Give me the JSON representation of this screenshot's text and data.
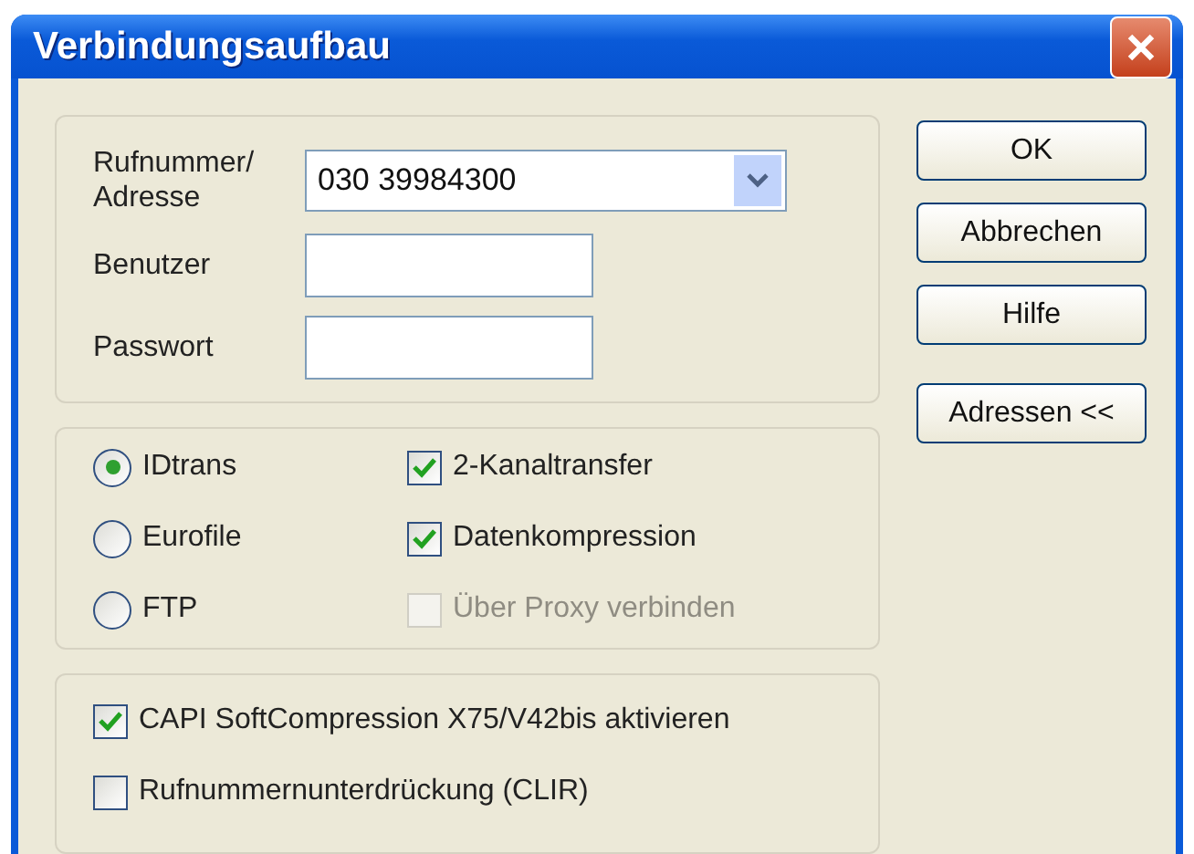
{
  "window": {
    "title": "Verbindungsaufbau"
  },
  "connection": {
    "address_label": "Rufnummer/ Adresse",
    "address_value": "030 39984300",
    "user_label": "Benutzer",
    "password_label": "Passwort"
  },
  "protocols": [
    {
      "label": "IDtrans",
      "selected": true
    },
    {
      "label": "Eurofile",
      "selected": false
    },
    {
      "label": "FTP",
      "selected": false
    }
  ],
  "options": [
    {
      "label": "2-Kanaltransfer",
      "checked": true,
      "disabled": false
    },
    {
      "label": "Datenkompression",
      "checked": true,
      "disabled": false
    },
    {
      "label": "Über Proxy verbinden",
      "checked": false,
      "disabled": true
    }
  ],
  "capi_options": [
    {
      "label": "CAPI SoftCompression X75/V42bis aktivieren",
      "checked": true
    },
    {
      "label": "Rufnummernunterdrückung (CLIR)",
      "checked": false
    }
  ],
  "buttons": [
    {
      "label": "OK"
    },
    {
      "label": "Abbrechen"
    },
    {
      "label": "Hilfe"
    },
    {
      "label": "Adressen <<"
    }
  ]
}
